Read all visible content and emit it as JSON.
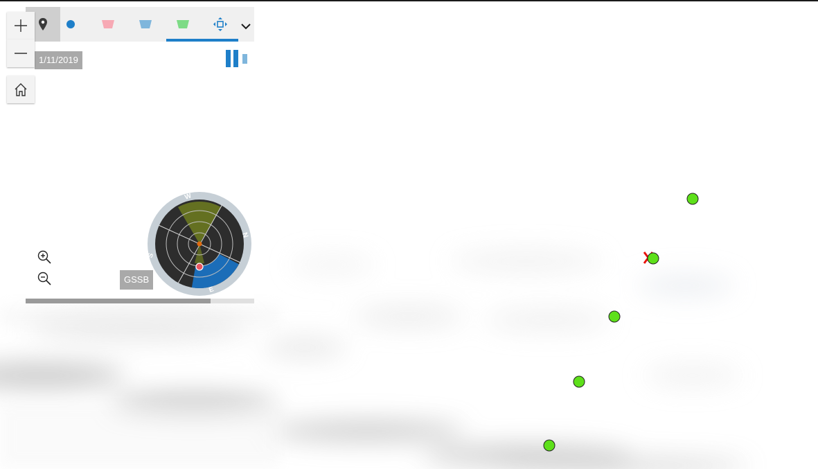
{
  "toolbar": {
    "tools": [
      {
        "name": "pin-tool",
        "icon": "map-pin-icon",
        "active": true
      },
      {
        "name": "point-tool",
        "icon": "blue-dot-icon",
        "color": "#1e7fc9"
      },
      {
        "name": "pink-layer-tool",
        "icon": "pink-trapezoid-icon",
        "color": "#f7a9b4"
      },
      {
        "name": "blue-layer-tool",
        "icon": "blue-trapezoid-icon",
        "color": "#7fb6dc"
      },
      {
        "name": "green-layer-tool",
        "icon": "green-trapezoid-icon",
        "color": "#7ddb86"
      },
      {
        "name": "pan-tool",
        "icon": "move-arrows-icon",
        "color": "#1e7fc9"
      }
    ],
    "more_icon": "chevron-down-icon"
  },
  "panel": {
    "date": "1/11/2019",
    "station": "GSSB",
    "progress_percent": 81,
    "radar": {
      "directions": [
        "W",
        "N",
        "E",
        "S"
      ],
      "colors": {
        "ring": "#c6cfd6",
        "dial": "#2d2d2d",
        "sector": "#6f7d20",
        "arc": "#1b6db8",
        "center": "#e06a10",
        "dot": "#e85560"
      }
    }
  },
  "nav": {
    "zoom_in_icon": "plus-icon",
    "zoom_out_icon": "minus-icon",
    "home_icon": "home-icon"
  },
  "map": {
    "marker_color": "#5ee01a",
    "alert_color": "#e8120c"
  }
}
